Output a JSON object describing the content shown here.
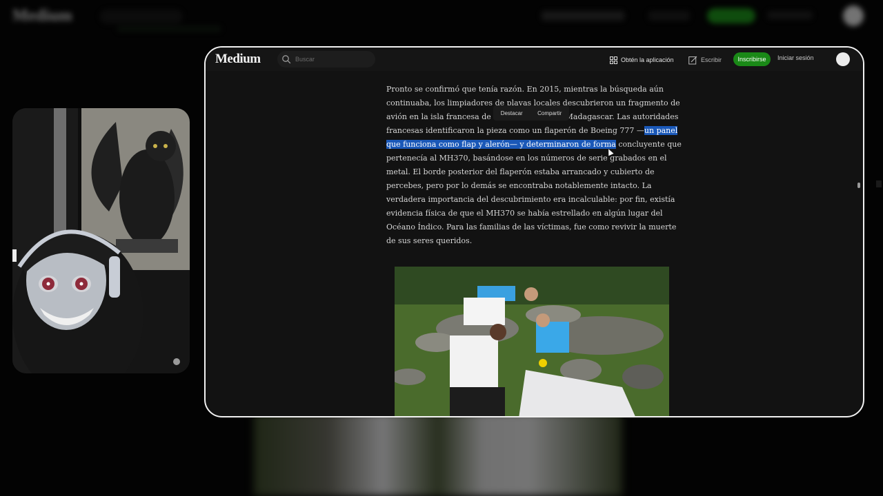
{
  "background": {
    "logo": "Medium"
  },
  "navbar": {
    "logo": "Medium",
    "search_placeholder": "Buscar",
    "get_app_label": "Obtén la aplicación",
    "write_label": "Escribir",
    "signup_label": "Inscribirse",
    "login_label": "Iniciar sesión"
  },
  "selection_popup": {
    "highlight_label": "Destacar",
    "share_label": "Compartir"
  },
  "article": {
    "paragraph_before_highlight": "Pronto se confirmó que tenía razón. En 2015, mientras la búsqueda aún continuaba, los limpiadores de playas locales descubrieron un fragmento de avión en la isla francesa de Reunión, cerca de Madagascar. Las autoridades francesas identificaron la pieza como un flaperón de Boeing 777 —",
    "highlighted_text": "un panel que funciona como flap y alerón— y determinaron de forma",
    "paragraph_after_highlight": " concluyente que pertenecía al MH370, basándose en los números de serie grabados en el metal. El borde posterior del flaperón estaba arrancado y cubierto de percebes, pero por lo demás se encontraba notablemente intacto. La verdadera importancia del descubrimiento era incalculable: por fin, existía evidencia física de que el MH370 se había estrellado en algún lugar del Océano Índico. Para las familias de las víctimas, fue como revivir la muerte de sus seres queridos."
  },
  "colors": {
    "accent_green": "#1a8917",
    "selection_blue": "#1a58b8",
    "page_bg": "#121212"
  },
  "icons": {
    "search": "search-icon",
    "app": "app-grid-icon",
    "write": "write-icon"
  }
}
